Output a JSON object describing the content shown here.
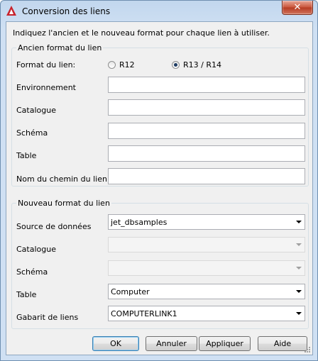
{
  "window": {
    "title": "Conversion des liens",
    "close_symbol": "✕"
  },
  "instruction": "Indiquez l'ancien et le nouveau format pour chaque lien à utiliser.",
  "old_format": {
    "legend": "Ancien format du lien",
    "format_label": "Format du lien:",
    "radio_r12": "R12",
    "radio_r13": "R13 / R14",
    "selected": "R13 / R14",
    "environment_label": "Environnement",
    "catalog_label": "Catalogue",
    "schema_label": "Schéma",
    "table_label": "Table",
    "path_label": "Nom du chemin du lien",
    "environment_value": "",
    "catalog_value": "",
    "schema_value": "",
    "table_value": "",
    "path_value": ""
  },
  "new_format": {
    "legend": "Nouveau format du lien",
    "source_label": "Source de données",
    "source_value": "jet_dbsamples",
    "catalog_label": "Catalogue",
    "catalog_value": "",
    "schema_label": "Schéma",
    "schema_value": "",
    "table_label": "Table",
    "table_value": "Computer",
    "template_label": "Gabarit de liens",
    "template_value": "COMPUTERLINK1"
  },
  "buttons": {
    "ok": "OK",
    "cancel": "Annuler",
    "apply": "Appliquer",
    "help": "Aide"
  },
  "colors": {
    "radio_dot": "#1f3d64",
    "close": "#c9543a",
    "app_icon": "#c8232c"
  }
}
